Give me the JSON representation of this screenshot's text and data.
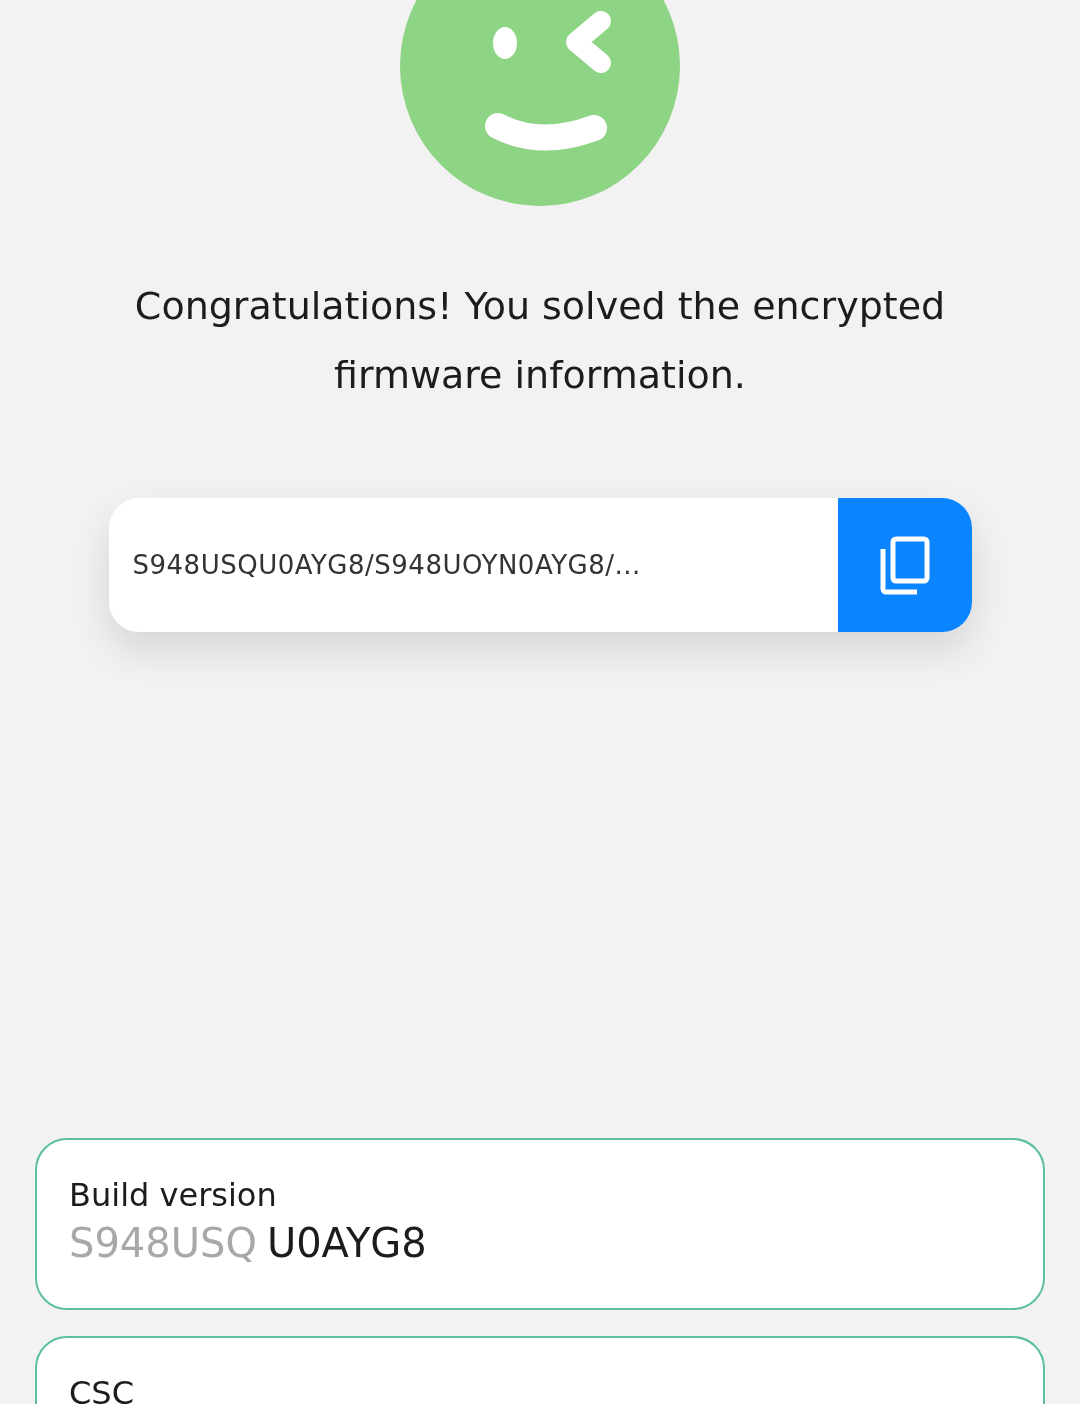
{
  "message": "Congratulations! You solved the encrypted firmware information.",
  "firmware_field": {
    "value": "S948USQU0AYG8/S948UOYN0AYG8/..."
  },
  "info_cards": [
    {
      "label": "Build version",
      "value_prefix": "S948USQ",
      "value": "U0AYG8"
    },
    {
      "label": "CSC"
    }
  ]
}
